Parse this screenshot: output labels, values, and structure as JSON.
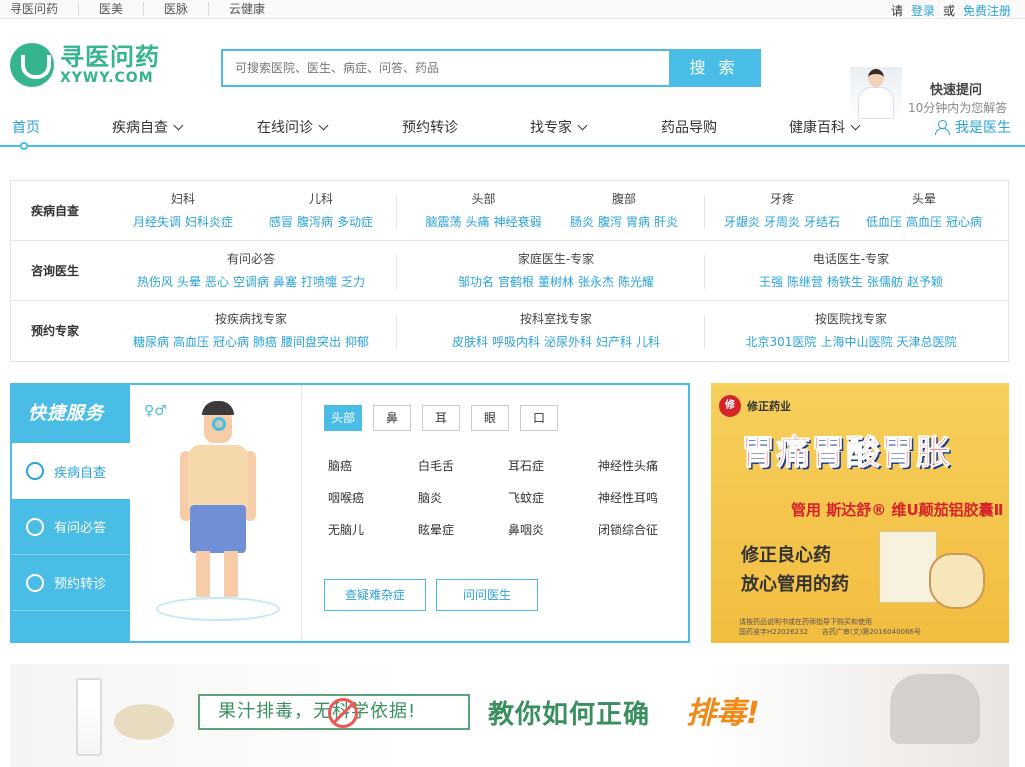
{
  "topbar": {
    "links": [
      "寻医问药",
      "医美",
      "医脉",
      "云健康"
    ],
    "please": "请",
    "login": "登录",
    "or": "或",
    "register": "免费注册"
  },
  "logo": {
    "cn": "寻医问药",
    "en": "XYWY.COM"
  },
  "search": {
    "placeholder": "可搜索医院、医生、病症、问答、药品",
    "button": "搜 索"
  },
  "quick_ask": {
    "title": "快速提问",
    "subtitle": "10分钟内为您解答"
  },
  "nav": {
    "items": [
      "首页",
      "疾病自查",
      "在线问诊",
      "预约转诊",
      "找专家",
      "药品导购",
      "健康百科"
    ],
    "doctor": "我是医生"
  },
  "grid": {
    "rows": [
      {
        "label": "疾病自查",
        "cells": [
          {
            "title": "妇科",
            "links": [
              "月经失调",
              "妇科炎症"
            ]
          },
          {
            "title": "儿科",
            "links": [
              "感冒",
              "腹泻病",
              "多动症"
            ]
          },
          {
            "title": "头部",
            "links": [
              "脑震荡",
              "头痛",
              "神经衰弱"
            ]
          },
          {
            "title": "腹部",
            "links": [
              "肠炎",
              "腹泻",
              "胃病",
              "肝炎"
            ]
          },
          {
            "title": "牙疼",
            "links": [
              "牙龈炎",
              "牙周炎",
              "牙结石"
            ]
          },
          {
            "title": "头晕",
            "links": [
              "低血压",
              "高血压",
              "冠心病"
            ]
          }
        ]
      },
      {
        "label": "咨询医生",
        "cells": [
          {
            "title": "有问必答",
            "links": [
              "热伤风",
              "头晕",
              "恶心",
              "空调病",
              "鼻塞",
              "打喷嚏",
              "乏力"
            ]
          },
          {
            "title": "家庭医生-专家",
            "links": [
              "邹功名",
              "官鹤根",
              "董树林",
              "张永杰",
              "陈光耀"
            ]
          },
          {
            "title": "电话医生-专家",
            "links": [
              "王强",
              "陈继营",
              "杨铁生",
              "张儒舫",
              "赵予颖"
            ]
          }
        ]
      },
      {
        "label": "预约专家",
        "cells": [
          {
            "title": "按疾病找专家",
            "links": [
              "糖尿病",
              "高血压",
              "冠心病",
              "肺癌",
              "腰间盘突出",
              "抑郁"
            ]
          },
          {
            "title": "按科室找专家",
            "links": [
              "皮肤科",
              "呼吸内科",
              "泌尿外科",
              "妇产科",
              "儿科"
            ]
          },
          {
            "title": "按医院找专家",
            "links": [
              "北京301医院",
              "上海中山医院",
              "天津总医院"
            ]
          }
        ]
      }
    ]
  },
  "services": {
    "title": "快捷服务",
    "tabs": [
      "疾病自查",
      "有问必答",
      "预约转诊"
    ],
    "gender": "♀♂",
    "body_parts": [
      "头部",
      "鼻",
      "耳",
      "眼",
      "口"
    ],
    "diseases": [
      "脑癌",
      "白毛舌",
      "耳石症",
      "神经性头痛",
      "咽喉癌",
      "脑炎",
      "飞蚊症",
      "神经性耳鸣",
      "无脑儿",
      "眩晕症",
      "鼻咽炎",
      "闭锁综合征"
    ],
    "buttons": [
      "查疑难杂症",
      "问问医生"
    ]
  },
  "ad": {
    "brand_badge": "修",
    "brand": "修正药业",
    "headline": "胃痛胃酸胃胀",
    "sub": "管用 斯达舒® 维U颠茄铝胶囊Ⅱ",
    "line1": "修正良心药",
    "line2": "放心管用的药",
    "fine1": "请按药品说明书或在药师指导下购买和使用",
    "fine2": "国药准字H22026232　　吉药广审(文)第2016040066号"
  },
  "banner": {
    "pill": "果汁排毒，无科学依据!",
    "main": "教你如何正确",
    "highlight": "排毒!"
  }
}
